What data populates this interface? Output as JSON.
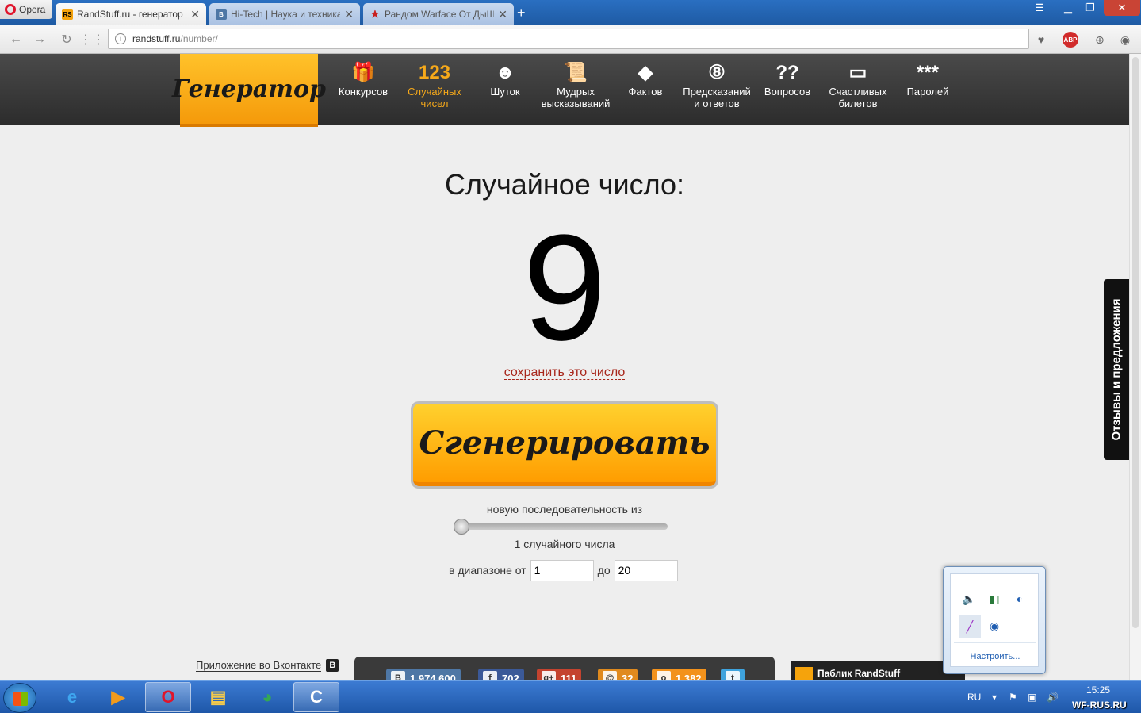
{
  "browser": {
    "opera_label": "Opera",
    "tabs": [
      {
        "title": "RandStuff.ru - генератор слу",
        "favicon": "RS"
      },
      {
        "title": "Hi-Tech | Наука и техника",
        "favicon": "B"
      },
      {
        "title": "Рандом Warface От ДыШи",
        "favicon": "★"
      }
    ],
    "url_host": "randstuff.ru",
    "url_path": "/number/",
    "abp_label": "ABP"
  },
  "site": {
    "logo": "Генератор",
    "nav": [
      {
        "icon": "gift-icon",
        "glyph": "🎁",
        "label1": "Конкурсов",
        "label2": ""
      },
      {
        "icon": "numbers-icon",
        "glyph": "123",
        "label1": "Случайных",
        "label2": "чисел"
      },
      {
        "icon": "smile-icon",
        "glyph": "☻",
        "label1": "Шуток",
        "label2": ""
      },
      {
        "icon": "scroll-icon",
        "glyph": "📜",
        "label1": "Мудрых",
        "label2": "высказываний"
      },
      {
        "icon": "warning-icon",
        "glyph": "◆",
        "label1": "Фактов",
        "label2": ""
      },
      {
        "icon": "eight-ball-icon",
        "glyph": "⑧",
        "label1": "Предсказаний",
        "label2": "и ответов"
      },
      {
        "icon": "questions-icon",
        "glyph": "??",
        "label1": "Вопросов",
        "label2": ""
      },
      {
        "icon": "ticket-icon",
        "glyph": "▭",
        "label1": "Счастливых",
        "label2": "билетов"
      },
      {
        "icon": "asterisks-icon",
        "glyph": "***",
        "label1": "Паролей",
        "label2": ""
      }
    ],
    "heading": "Случайное число:",
    "number": "9",
    "save_link": "сохранить это число",
    "generate_button": "Сгенерировать",
    "sequence_label": "новую последовательность из",
    "slider_value": 1,
    "count_label": "1 случайного числа",
    "range_from_label": "в диапазоне от",
    "range_from": "1",
    "range_to_label": "до",
    "range_to": "20",
    "feedback_tab": "Отзывы и предложения",
    "vk_app_link": "Приложение во Вконтакте",
    "vk_badge": "B",
    "social": [
      {
        "icon": "vk-icon",
        "glyph": "B",
        "count": "1 974 600",
        "color": "#4e77a5"
      },
      {
        "icon": "facebook-icon",
        "glyph": "f",
        "count": "702",
        "color": "#3b5998"
      },
      {
        "icon": "gplus-icon",
        "glyph": "g+",
        "count": "111",
        "color": "#c4432f"
      },
      {
        "icon": "ok-icon",
        "glyph": "@",
        "count": "32",
        "color": "#e08a1e"
      },
      {
        "icon": "odnoklassniki-icon",
        "glyph": "о",
        "count": "1 382",
        "color": "#f3921c"
      },
      {
        "icon": "twitter-icon",
        "glyph": "t",
        "count": "",
        "color": "#3ea3dd"
      }
    ],
    "public_label": "Паблик RandStuff"
  },
  "tray": {
    "configure_label": "Настроить...",
    "lang": "RU",
    "time": "15:25"
  },
  "watermark": "WF-RUS.RU"
}
